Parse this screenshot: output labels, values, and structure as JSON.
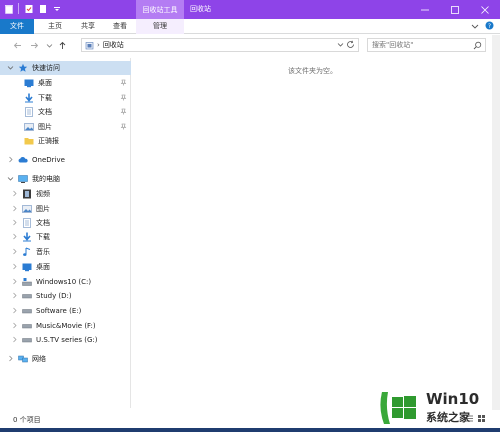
{
  "titlebar": {
    "context_tab": "回收站工具",
    "window_title": "回收站",
    "minimize": "─",
    "maximize": "☐",
    "close": "✕"
  },
  "ribbon": {
    "tabs": [
      {
        "label": "文件"
      },
      {
        "label": "主页"
      },
      {
        "label": "共享"
      },
      {
        "label": "查看"
      },
      {
        "label": "管理"
      }
    ]
  },
  "address": {
    "crumb": "回收站",
    "search_placeholder": "搜索\"回收站\""
  },
  "navpane": {
    "quick_access": "快速访问",
    "quick_items": [
      {
        "label": "桌面",
        "icon": "desktop-icon",
        "pinned": true
      },
      {
        "label": "下载",
        "icon": "download-icon",
        "pinned": true
      },
      {
        "label": "文档",
        "icon": "document-icon",
        "pinned": true
      },
      {
        "label": "图片",
        "icon": "picture-icon",
        "pinned": true
      },
      {
        "label": "正骑报",
        "icon": "folder-icon",
        "pinned": false
      }
    ],
    "onedrive": "OneDrive",
    "this_pc": "我的电脑",
    "pc_items": [
      {
        "label": "视频",
        "icon": "video-icon"
      },
      {
        "label": "图片",
        "icon": "picture-icon"
      },
      {
        "label": "文档",
        "icon": "document-icon"
      },
      {
        "label": "下载",
        "icon": "download-icon"
      },
      {
        "label": "音乐",
        "icon": "music-icon"
      },
      {
        "label": "桌面",
        "icon": "desktop-icon"
      },
      {
        "label": "Windows10 (C:)",
        "icon": "system-drive-icon"
      },
      {
        "label": "Study (D:)",
        "icon": "drive-icon"
      },
      {
        "label": "Software (E:)",
        "icon": "drive-icon"
      },
      {
        "label": "Music&Movie (F:)",
        "icon": "drive-icon"
      },
      {
        "label": "U.S.TV series  (G:)",
        "icon": "drive-icon"
      }
    ],
    "network": "网络"
  },
  "content": {
    "empty_message": "该文件夹为空。"
  },
  "status": {
    "item_count": "0 个项目"
  },
  "watermark": {
    "brand": "Win10",
    "tagline": "系统之家"
  },
  "colors": {
    "titlebar": "#8e44e8",
    "context_tab": "#b47cf3",
    "file_tab": "#1979ca",
    "selection": "#ccdff2"
  }
}
